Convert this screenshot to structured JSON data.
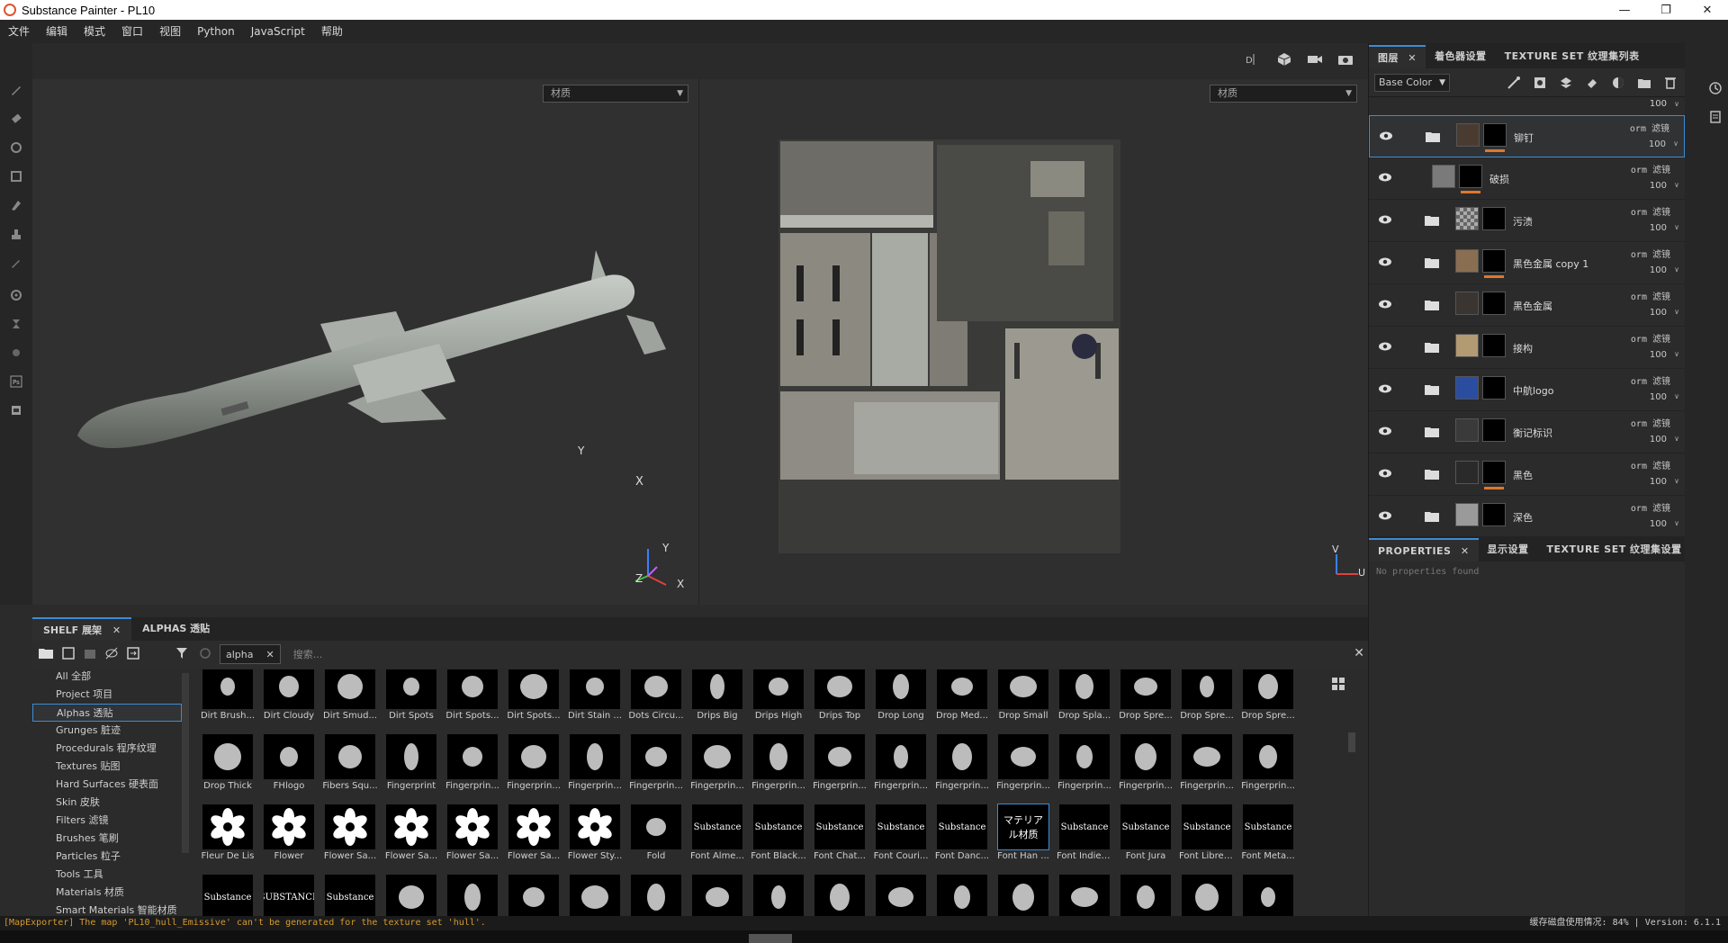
{
  "window": {
    "title": "Substance Painter - PL10"
  },
  "menu": [
    "文件",
    "编辑",
    "模式",
    "窗口",
    "视图",
    "Python",
    "JavaScript",
    "帮助"
  ],
  "viewport": {
    "left_select": "材质",
    "right_select": "材质",
    "axis3d": {
      "x": "X",
      "y": "Y",
      "z": "Z"
    },
    "axis2d": {
      "v": "V",
      "u": "U"
    }
  },
  "layer_panel": {
    "tabs": [
      "图层",
      "着色器设置",
      "TEXTURE SET 纹理集列表"
    ],
    "channel": "Base Color",
    "top_opacity": "100",
    "layers": [
      {
        "name": "铆钉",
        "blend": "orm 滤镜",
        "opacity": "100",
        "folder": true,
        "selected": true,
        "thumb": "#4a3b30",
        "bar": true
      },
      {
        "name": "破损",
        "blend": "orm 滤镜",
        "opacity": "100",
        "folder": false,
        "selected": false,
        "thumb": "#7a7a7a",
        "bar": true
      },
      {
        "name": "污渍",
        "blend": "orm 滤镜",
        "opacity": "100",
        "folder": true,
        "selected": false,
        "thumb": "checker",
        "bar": false
      },
      {
        "name": "黑色金属 copy 1",
        "blend": "orm 滤镜",
        "opacity": "100",
        "folder": true,
        "selected": false,
        "thumb": "#8a6e52",
        "bar": true
      },
      {
        "name": "黑色金属",
        "blend": "orm 滤镜",
        "opacity": "100",
        "folder": true,
        "selected": false,
        "thumb": "#3a3530",
        "bar": false
      },
      {
        "name": "接构",
        "blend": "orm 滤镜",
        "opacity": "100",
        "folder": true,
        "selected": false,
        "thumb": "#b29a72",
        "bar": false
      },
      {
        "name": "中航logo",
        "blend": "orm 滤镜",
        "opacity": "100",
        "folder": true,
        "selected": false,
        "thumb": "#2a4da0",
        "bar": false
      },
      {
        "name": "衡记标识",
        "blend": "orm 滤镜",
        "opacity": "100",
        "folder": true,
        "selected": false,
        "thumb": "#3a3a3a",
        "bar": false
      },
      {
        "name": "黑色",
        "blend": "orm 滤镜",
        "opacity": "100",
        "folder": true,
        "selected": false,
        "thumb": "#2a2a2a",
        "bar": true
      },
      {
        "name": "深色",
        "blend": "orm 滤镜",
        "opacity": "100",
        "folder": true,
        "selected": false,
        "thumb": "#9a9a9a",
        "bar": false
      }
    ]
  },
  "properties": {
    "tabs": [
      "PROPERTIES",
      "显示设置",
      "TEXTURE SET 纹理集设置"
    ],
    "empty": "No properties found"
  },
  "shelf": {
    "tabs": [
      "SHELF 展架",
      "ALPHAS 透贴"
    ],
    "filter_tag": "alpha",
    "search_placeholder": "搜索...",
    "categories": [
      "All 全部",
      "Project 项目",
      "Alphas 透贴",
      "Grunges 脏迹",
      "Procedurals 程序纹理",
      "Textures 贴图",
      "Hard Surfaces 硬表面",
      "Skin 皮肤",
      "Filters 滤镜",
      "Brushes 笔刷",
      "Particles 粒子",
      "Tools 工具",
      "Materials 材质",
      "Smart Materials 智能材质"
    ],
    "active_category": 2,
    "rows": [
      [
        "Dirt Brush...",
        "Dirt Cloudy",
        "Dirt Smud...",
        "Dirt Spots",
        "Dirt Spots...",
        "Dirt Spots...",
        "Dirt Stain ...",
        "Dots Circu...",
        "Drips Big",
        "Drips High",
        "Drips Top",
        "Drop Long",
        "Drop Med...",
        "Drop Small",
        "Drop Spla...",
        "Drop Spre...",
        "Drop Spre...",
        "Drop Spre..."
      ],
      [
        "Drop Thick",
        "FHlogo",
        "Fibers Squ...",
        "Fingerprint",
        "Fingerprin...",
        "Fingerprin...",
        "Fingerprin...",
        "Fingerprin...",
        "Fingerprin...",
        "Fingerprin...",
        "Fingerprin...",
        "Fingerprin...",
        "Fingerprin...",
        "Fingerprin...",
        "Fingerprin...",
        "Fingerprin...",
        "Fingerprin...",
        "Fingerprin..."
      ],
      [
        "Fleur De Lis",
        "Flower",
        "Flower Sa...",
        "Flower Sa...",
        "Flower Sa...",
        "Flower Sa...",
        "Flower Sty...",
        "Fold",
        "Font Alme...",
        "Font Black...",
        "Font Chat...",
        "Font Couri...",
        "Font Danc...",
        "Font Han ...",
        "Font Indie ...",
        "Font Jura",
        "Font Libre ...",
        "Font Meta..."
      ],
      [
        "",
        "",
        "",
        "",
        "",
        "",
        "",
        "",
        "",
        "",
        "",
        "",
        "",
        "",
        "",
        "",
        "",
        ""
      ]
    ],
    "font_samples": {
      "r2c8": "Substance",
      "r2c9": "Substance",
      "r2c10": "Substance",
      "r2c11": "Substance",
      "r2c12": "Substance",
      "r2c13": "マテリアル材质",
      "r2c14": "Substance",
      "r2c15": "Substance",
      "r2c16": "Substance",
      "r2c17": "Substance",
      "r3c0": "Substance",
      "r3c1": "SUBSTANCE",
      "r3c2": "Substance"
    }
  },
  "status": {
    "message": "[MapExporter] The map 'PL10_hull_Emissive' can't be generated for the texture set 'hull'.",
    "right": "缓存磁盘使用情况:  84% | Version: 6.1.1"
  }
}
